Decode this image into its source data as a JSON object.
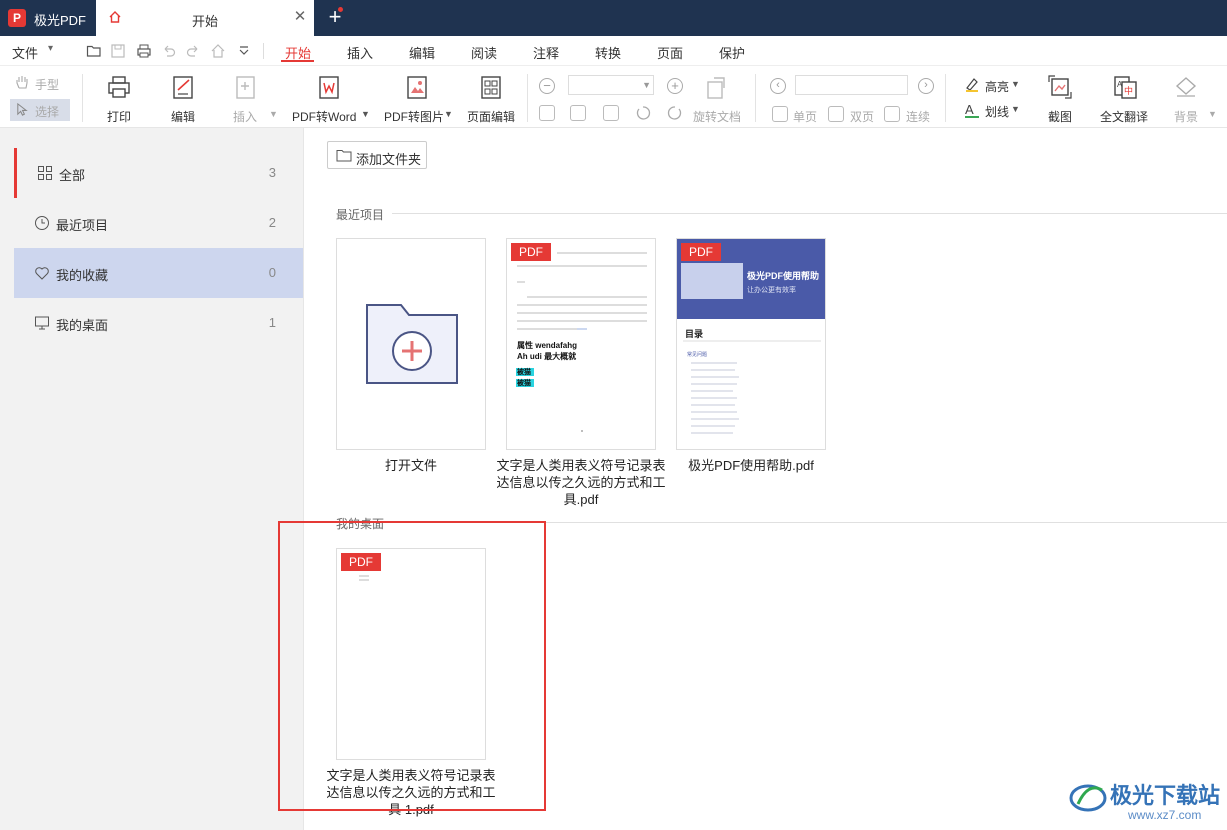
{
  "app": {
    "logo_letter": "P",
    "title": "极光PDF"
  },
  "tabs": {
    "active_label": "开始",
    "close_symbol": "✕",
    "new_symbol": "+"
  },
  "menu": {
    "file_label": "文件",
    "tabs": [
      "开始",
      "插入",
      "编辑",
      "阅读",
      "注释",
      "转换",
      "页面",
      "保护"
    ]
  },
  "ribbon": {
    "hand": "手型",
    "select": "选择",
    "print": "打印",
    "edit": "编辑",
    "insert": "插入",
    "pdf_to_word": "PDF转Word",
    "pdf_to_image": "PDF转图片",
    "page_edit": "页面编辑",
    "rotate_doc": "旋转文档",
    "single_page": "单页",
    "double_page": "双页",
    "continuous": "连续",
    "highlight": "高亮",
    "underline": "划线",
    "screenshot": "截图",
    "translate": "全文翻译",
    "background": "背景"
  },
  "sidebar": {
    "items": [
      {
        "label": "全部",
        "count": "3",
        "icon": "grid-icon"
      },
      {
        "label": "最近项目",
        "count": "2",
        "icon": "clock-icon"
      },
      {
        "label": "我的收藏",
        "count": "0",
        "icon": "heart-icon"
      },
      {
        "label": "我的桌面",
        "count": "1",
        "icon": "monitor-icon"
      }
    ]
  },
  "main": {
    "add_folder": "添加文件夹",
    "recent_section": "最近项目",
    "desktop_section": "我的桌面",
    "open_file": "打开文件",
    "pdf_badge": "PDF",
    "recent_files": [
      "文字是人类用表义符号记录表达信息以传之久远的方式和工具.pdf",
      "极光PDF使用帮助.pdf"
    ],
    "desktop_files": [
      "文字是人类用表义符号记录表达信息以传之久远的方式和工具 1.pdf"
    ],
    "thumb1": {
      "bold1": "属性 wendafahg",
      "bold2": "Ah udi 最大概就",
      "hl1": "被猫",
      "hl2": "被猫"
    },
    "thumb2": {
      "banner_title": "极光PDF使用帮助",
      "banner_sub": "让办公更有效率",
      "toc": "目录",
      "toc_head": "常见问题"
    }
  },
  "watermark": {
    "text": "极光下载站",
    "url": "www.xz7.com"
  },
  "colors": {
    "accent": "#e53935",
    "titlebar": "#1f3350",
    "fav_bg": "#cdd6ee"
  }
}
